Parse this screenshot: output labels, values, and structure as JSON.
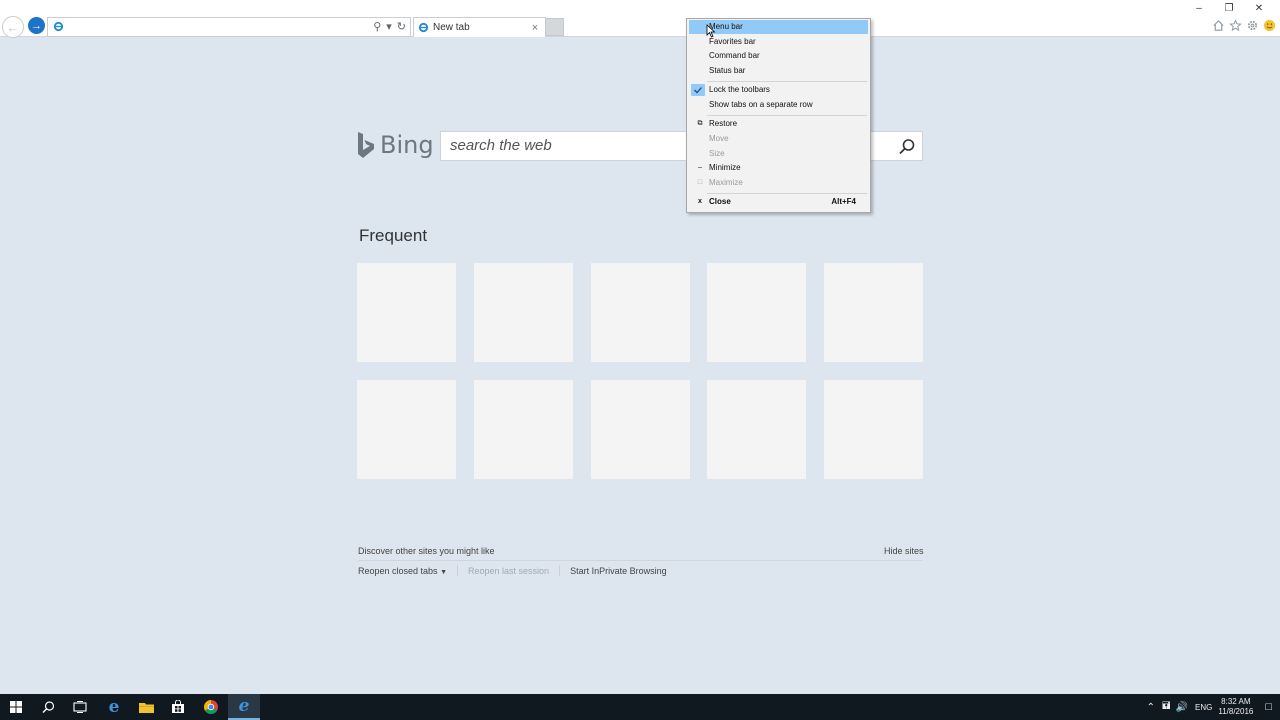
{
  "browser": {
    "tab_label": "New tab",
    "tab_close": "×",
    "address_value": "",
    "window_controls": [
      "–",
      "❐",
      "✕"
    ]
  },
  "bing": {
    "logo_text": "Bing",
    "search_placeholder": "search the web"
  },
  "frequent": {
    "title": "Frequent",
    "tile_count": 10
  },
  "footer": {
    "discover": "Discover other sites you might like",
    "hide_sites": "Hide sites",
    "reopen_closed_tabs": "Reopen closed tabs",
    "reopen_last_session": "Reopen last session",
    "start_inprivate": "Start InPrivate Browsing"
  },
  "context_menu": {
    "items": [
      {
        "label": "Menu bar",
        "state": "selected"
      },
      {
        "label": "Favorites bar",
        "state": "normal"
      },
      {
        "label": "Command bar",
        "state": "normal"
      },
      {
        "label": "Status bar",
        "state": "normal"
      },
      {
        "label": "Lock the toolbars",
        "state": "checked"
      },
      {
        "label": "Show tabs on a separate row",
        "state": "normal"
      },
      {
        "label": "Restore",
        "state": "normal",
        "glyph": "restore"
      },
      {
        "label": "Move",
        "state": "disabled"
      },
      {
        "label": "Size",
        "state": "disabled"
      },
      {
        "label": "Minimize",
        "state": "normal",
        "glyph": "minimize"
      },
      {
        "label": "Maximize",
        "state": "disabled",
        "glyph": "maximize"
      },
      {
        "label": "Close",
        "state": "bold",
        "glyph": "close",
        "shortcut": "Alt+F4"
      }
    ]
  },
  "taskbar": {
    "language": "ENG",
    "time": "8:32 AM",
    "date": "11/8/2016"
  },
  "colors": {
    "page_bg": "#dde6ee",
    "menu_highlight": "#91c9f7",
    "ie_blue": "#1e73c8",
    "taskbar": "#101820"
  }
}
